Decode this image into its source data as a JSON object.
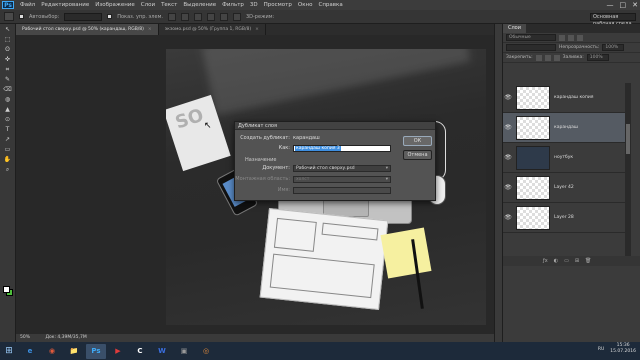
{
  "app": {
    "logo": "Ps",
    "menu": [
      "Файл",
      "Редактирование",
      "Изображение",
      "Слои",
      "Текст",
      "Выделение",
      "Фильтр",
      "3D",
      "Просмотр",
      "Окно",
      "Справка"
    ],
    "window_controls": [
      "—",
      "□",
      "✕"
    ]
  },
  "options": {
    "auto_select_label": "Автовыбор:",
    "auto_select_value": "",
    "transform_label": "Показ. упр. элем.",
    "mode_3d_label": "3D-режим:",
    "workspace": "Основная рабочая среда"
  },
  "tabs": [
    {
      "label": "Рабочий стол сверху.psd @ 50% (карандаш, RGB/8)",
      "close": "×",
      "active": true
    },
    {
      "label": "экзомо.psd @ 50% (Группа 1, RGB/8)",
      "close": "×",
      "active": false
    }
  ],
  "tools": [
    "↖",
    "⬚",
    "ʘ",
    "✜",
    "⌗",
    "✎",
    "⌫",
    "◍",
    "▲",
    "⊙",
    "T",
    "↗",
    "▭",
    "✋",
    "⌕"
  ],
  "canvas": {
    "paper_text": "SO",
    "cursor": "↖"
  },
  "dialog": {
    "title": "Дубликат слоя",
    "duplicate_label": "Создать дубликат:",
    "duplicate_value": "карандаш",
    "as_label": "Как:",
    "as_value": "карандаш копия 3",
    "section": "Назначение",
    "document_label": "Документ:",
    "document_value": "Рабочий стол сверху.psd",
    "artboard_label": "Монтажная область:",
    "artboard_value": "холст",
    "name_label": "Имя:",
    "ok": "ОК",
    "cancel": "Отмена"
  },
  "status": {
    "zoom": "50%",
    "doc": "Док: 4,39М/35,7М"
  },
  "layers_panel": {
    "tab": "Слои",
    "kind_label": "Обычные",
    "opacity_label": "Непрозрачность:",
    "opacity_value": "100%",
    "lock_label": "Закрепить:",
    "fill_label": "Заливка:",
    "fill_value": "100%",
    "layers": [
      {
        "name": "карандаш копия",
        "active": false,
        "dark": false
      },
      {
        "name": "карандаш",
        "active": true,
        "dark": false
      },
      {
        "name": "ноутбук",
        "active": false,
        "dark": true
      },
      {
        "name": "Layer 42",
        "active": false,
        "dark": false
      },
      {
        "name": "Layer 28",
        "active": false,
        "dark": false
      }
    ],
    "footer_icons": [
      "ƒx",
      "◐",
      "▭",
      "⊞",
      "🗑"
    ]
  },
  "taskbar": {
    "start": "⊞",
    "apps": [
      {
        "icon": "e",
        "color": "#3b8fe0",
        "active": false
      },
      {
        "icon": "◉",
        "color": "#e05a3b",
        "active": false
      },
      {
        "icon": "📁",
        "color": "#e0b23b",
        "active": false
      },
      {
        "icon": "Ps",
        "color": "#3fa9f5",
        "active": true
      },
      {
        "icon": "▶",
        "color": "#e03b3b",
        "active": false
      },
      {
        "icon": "C",
        "color": "#ffffff",
        "active": false
      },
      {
        "icon": "W",
        "color": "#3b6fe0",
        "active": false
      },
      {
        "icon": "▣",
        "color": "#9a9a9a",
        "active": false
      },
      {
        "icon": "◎",
        "color": "#e08a3b",
        "active": false
      }
    ],
    "lang": "RU",
    "time": "15:36",
    "date": "15.07.2016"
  }
}
